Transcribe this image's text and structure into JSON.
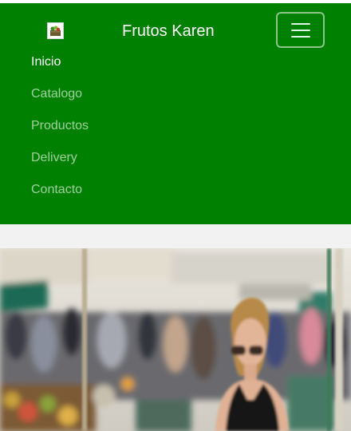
{
  "navbar": {
    "brand_name": "Frutos Karen",
    "logo_icon": "fruit-basket-logo-icon",
    "toggler_icon": "hamburger-menu-icon",
    "items": [
      {
        "label": "Inicio",
        "active": true
      },
      {
        "label": "Catalogo",
        "active": false
      },
      {
        "label": "Productos",
        "active": false
      },
      {
        "label": "Delivery",
        "active": false
      },
      {
        "label": "Contacto",
        "active": false
      }
    ]
  },
  "colors": {
    "navbar_bg": "#008000",
    "page_bg": "#f2f2f2"
  },
  "hero": {
    "image_description_icon": "market-shopper-photo"
  }
}
